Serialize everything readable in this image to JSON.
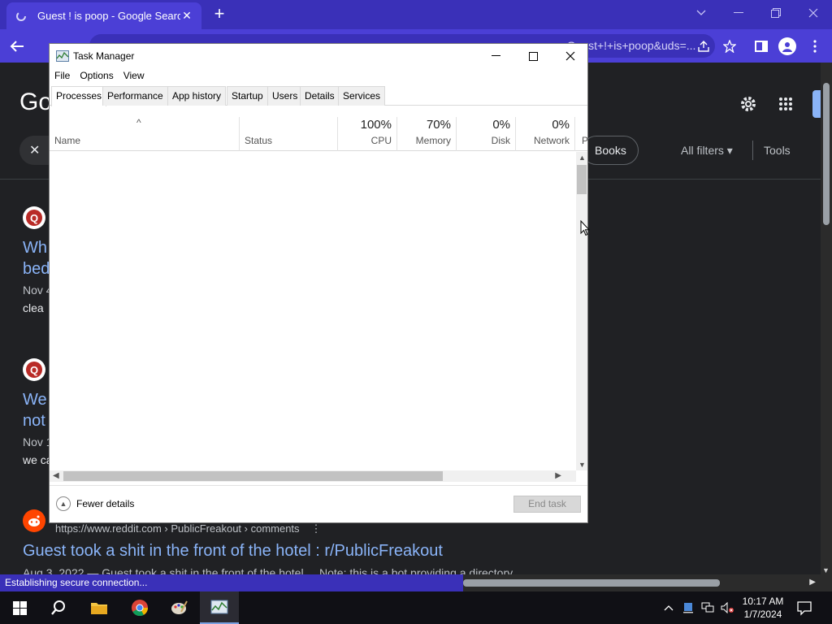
{
  "chrome": {
    "tab_title": "Guest ! is poop - Google Search",
    "omnibox_tail": "...q=Guest+!+is+poop&uds=..."
  },
  "google": {
    "logo_partial": "Go",
    "chip_books": "Books",
    "all_filters": "All filters",
    "tools": "Tools",
    "results": [
      {
        "title_l1": "Wh",
        "title_l2": "bed",
        "date": "Nov 4",
        "snippet": "clea"
      },
      {
        "title_l1": "We",
        "title_l2": "not",
        "date": "Nov 1",
        "snippet": "we ca"
      }
    ],
    "reddit": {
      "url": "https://www.reddit.com › PublicFreakout › comments",
      "title": "Guest took a shit in the front of the hotel : r/PublicFreakout",
      "snippet": "Aug 3, 2022 — Guest took a shit in the front of the hotel ... Note: this is a bot providing a directory"
    },
    "status_text": "Establishing secure connection..."
  },
  "task_manager": {
    "title": "Task Manager",
    "menu": [
      "File",
      "Options",
      "View"
    ],
    "tabs": [
      "Processes",
      "Performance",
      "App history",
      "Startup",
      "Users",
      "Details",
      "Services"
    ],
    "columns": {
      "name": "Name",
      "status": "Status",
      "cpu_pct": "100%",
      "cpu": "CPU",
      "mem_pct": "70%",
      "mem": "Memory",
      "disk_pct": "0%",
      "disk": "Disk",
      "net_pct": "0%",
      "net": "Network",
      "power_partial": "P"
    },
    "fewer_details": "Fewer details",
    "end_task": "End task"
  },
  "taskbar": {
    "time": "10:17 AM",
    "date": "1/7/2024"
  },
  "colors": {
    "chrome_frame": "#3a30b8",
    "chrome_toolbar": "#4b3fd6",
    "google_bg": "#202124",
    "link": "#8ab4f8"
  }
}
